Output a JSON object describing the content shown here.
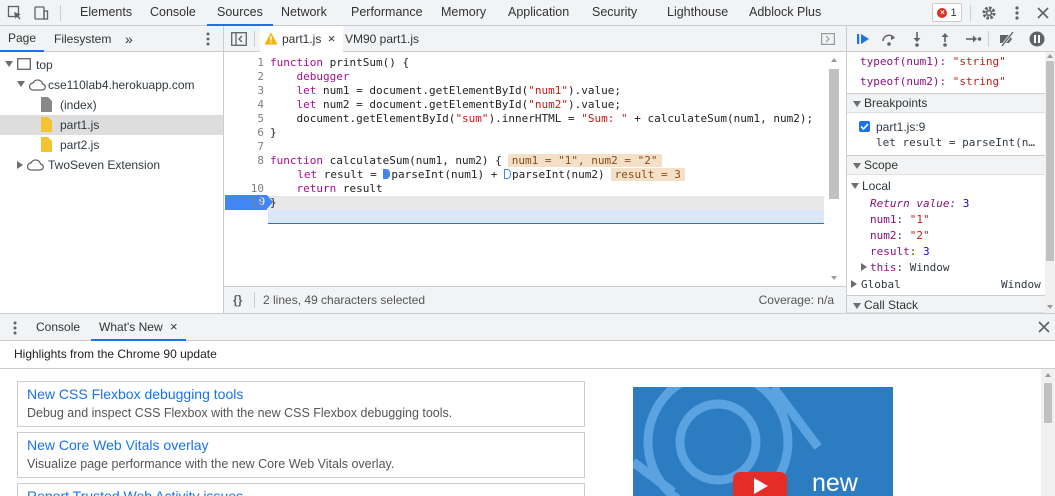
{
  "toolbar": {
    "tabs": [
      "Elements",
      "Console",
      "Sources",
      "Network",
      "Performance",
      "Memory",
      "Application",
      "Security",
      "Lighthouse",
      "Adblock Plus"
    ],
    "active_tab": "Sources",
    "error_count": "1"
  },
  "navigator": {
    "tabs": [
      "Page",
      "Filesystem"
    ],
    "more": "»",
    "tree": {
      "top": "top",
      "domain": "cse110lab4.herokuapp.com",
      "files": [
        "(index)",
        "part1.js",
        "part2.js"
      ],
      "extension": "TwoSeven Extension"
    }
  },
  "editor": {
    "tabs": [
      "part1.js",
      "VM90 part1.js"
    ],
    "close_glyph": "×",
    "line_numbers": [
      "1",
      "2",
      "3",
      "4",
      "5",
      "6",
      "7",
      "8",
      "9",
      "10",
      "11"
    ],
    "inline_values": {
      "line8": "num1 = \"1\", num2 = \"2\"",
      "line9": "result = 3"
    },
    "status": {
      "braces": "{}",
      "selection": "2 lines, 49 characters selected",
      "coverage": "Coverage: n/a"
    }
  },
  "debugger": {
    "watch": [
      {
        "expr": "typeof(num1)",
        "value": "\"string\""
      },
      {
        "expr": "typeof(num2)",
        "value": "\"string\""
      }
    ],
    "sections": {
      "breakpoints": "Breakpoints",
      "scope": "Scope",
      "call_stack": "Call Stack"
    },
    "breakpoint": {
      "location": "part1.js:9",
      "code": "let result = parseInt(n…"
    },
    "scope": {
      "local": "Local",
      "return_value_name": "Return value",
      "return_value": "3",
      "vars": [
        {
          "name": "num1",
          "value": "\"1\""
        },
        {
          "name": "num2",
          "value": "\"2\""
        },
        {
          "name": "result",
          "value": "3"
        }
      ],
      "this_name": "this",
      "this_value": "Window",
      "global": "Global",
      "global_value": "Window"
    }
  },
  "drawer": {
    "tabs": [
      "Console",
      "What's New"
    ],
    "active_tab": "What's New",
    "heading": "Highlights from the Chrome 90 update",
    "cards": [
      {
        "title": "New CSS Flexbox debugging tools",
        "desc": "Debug and inspect CSS Flexbox with the new CSS Flexbox debugging tools."
      },
      {
        "title": "New Core Web Vitals overlay",
        "desc": "Visualize page performance with the new Core Web Vitals overlay."
      },
      {
        "title": "Report Trusted Web Activity issues",
        "desc": ""
      }
    ],
    "video_text": "new"
  },
  "colors": {
    "accent": "#1a73e8",
    "keyword": "#aa0d91",
    "string": "#c41a16",
    "breakpoint": "#4285f4",
    "inline_value_bg": "#f4e0c7"
  }
}
